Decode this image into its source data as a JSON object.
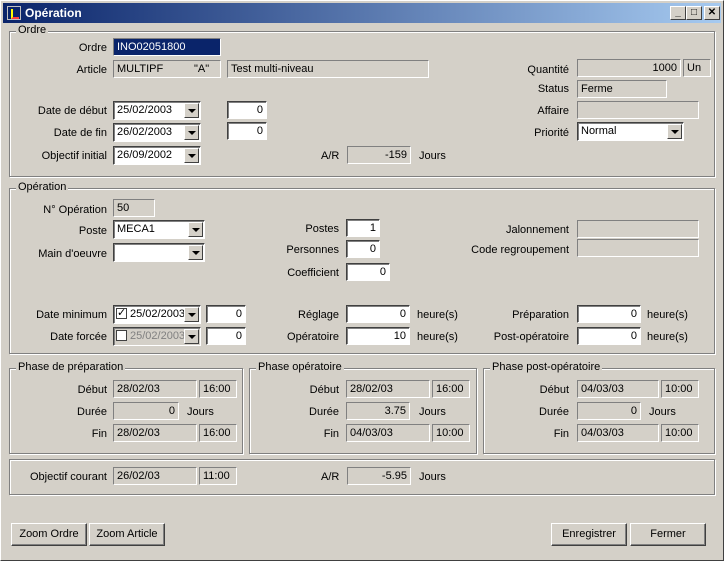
{
  "window": {
    "title": "Opération"
  },
  "ordre": {
    "legend": "Ordre",
    "ordre_label": "Ordre",
    "ordre_value": "INO02051800",
    "article_label": "Article",
    "article_code": "MULTIPF",
    "article_variant": "\"A\"",
    "article_desc": "Test multi-niveau",
    "quantite_label": "Quantité",
    "quantite_value": "1000",
    "quantite_unit": "Un",
    "status_label": "Status",
    "status_value": "Ferme",
    "affaire_label": "Affaire",
    "affaire_value": "",
    "priorite_label": "Priorité",
    "priorite_value": "Normal",
    "date_debut_label": "Date de début",
    "date_debut_value": "25/02/2003",
    "date_debut_num": "0",
    "date_fin_label": "Date de fin",
    "date_fin_value": "26/02/2003",
    "date_fin_num": "0",
    "objectif_label": "Objectif initial",
    "objectif_value": "26/09/2002",
    "ar_label": "A/R",
    "ar_value": "-159",
    "ar_unit": "Jours"
  },
  "operation": {
    "legend": "Opération",
    "no_label": "N° Opération",
    "no_value": "50",
    "poste_label": "Poste",
    "poste_value": "MECA1",
    "main_label": "Main d'oeuvre",
    "main_value": "",
    "postes_label": "Postes",
    "postes_value": "1",
    "personnes_label": "Personnes",
    "personnes_value": "0",
    "coef_label": "Coefficient",
    "coef_value": "0",
    "jalon_label": "Jalonnement",
    "jalon_value": "",
    "code_label": "Code regroupement",
    "code_value": "",
    "date_min_label": "Date minimum",
    "date_min_value": "25/02/2003",
    "date_min_num": "0",
    "date_forcee_label": "Date forcée",
    "date_forcee_value": "25/02/2003",
    "date_forcee_num": "0",
    "reglage_label": "Réglage",
    "reglage_value": "0",
    "operatoire_label": "Opératoire",
    "operatoire_value": "10",
    "heures": "heure(s)",
    "preparation_label": "Préparation",
    "preparation_value": "0",
    "post_label": "Post-opératoire",
    "post_value": "0"
  },
  "phases": {
    "prep": {
      "legend": "Phase de préparation",
      "debut": "28/02/03",
      "debut_h": "16:00",
      "duree": "0",
      "fin": "28/02/03",
      "fin_h": "16:00"
    },
    "oper": {
      "legend": "Phase opératoire",
      "debut": "28/02/03",
      "debut_h": "16:00",
      "duree": "3.75",
      "fin": "04/03/03",
      "fin_h": "10:00"
    },
    "post": {
      "legend": "Phase post-opératoire",
      "debut": "04/03/03",
      "debut_h": "10:00",
      "duree": "0",
      "fin": "04/03/03",
      "fin_h": "10:00"
    },
    "debut_label": "Début",
    "duree_label": "Durée",
    "fin_label": "Fin",
    "jours": "Jours"
  },
  "objectif_courant": {
    "label": "Objectif courant",
    "date": "26/02/03",
    "heure": "11:00",
    "ar_label": "A/R",
    "ar_value": "-5.95",
    "unit": "Jours"
  },
  "buttons": {
    "zoom_ordre": "Zoom Ordre",
    "zoom_article": "Zoom Article",
    "enregistrer": "Enregistrer",
    "fermer": "Fermer"
  },
  "title_buttons": {
    "minimize": "_",
    "maximize": "□",
    "close": "✕"
  }
}
